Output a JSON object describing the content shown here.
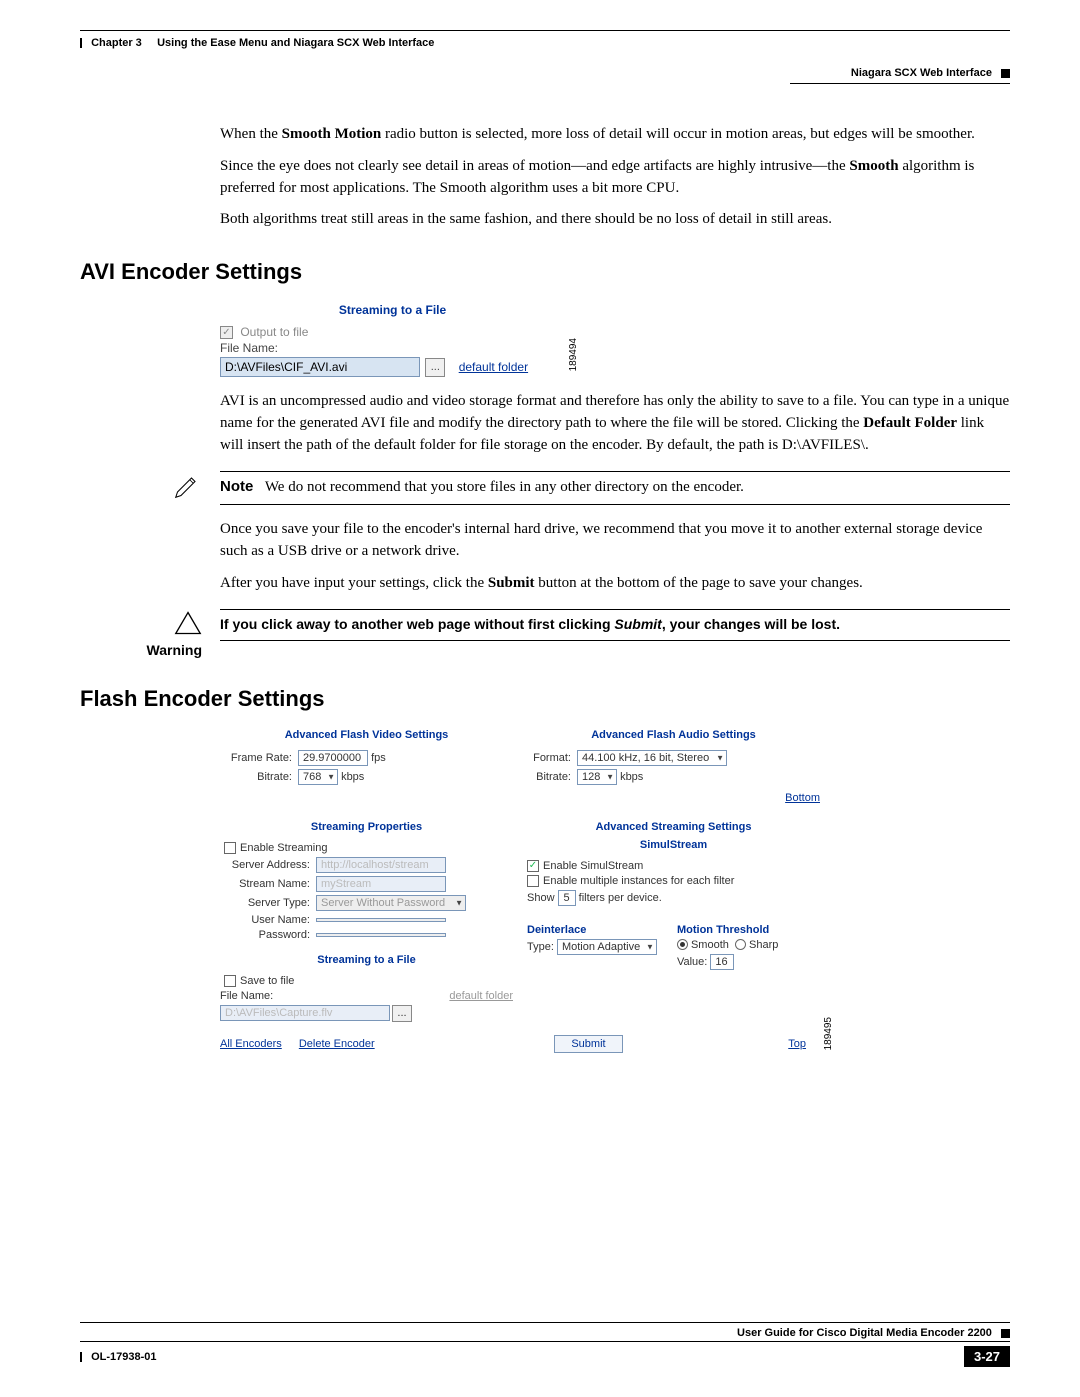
{
  "header": {
    "chapter_label": "Chapter 3",
    "chapter_title": "Using the Ease Menu and Niagara SCX Web Interface",
    "right_label": "Niagara SCX Web Interface"
  },
  "intro": {
    "p1_a": "When the ",
    "p1_b": "Smooth Motion",
    "p1_c": " radio button is selected, more loss of detail will occur in motion areas, but edges will be smoother.",
    "p2_a": "Since the eye does not clearly see detail in areas of motion—and edge artifacts are highly intrusive—the ",
    "p2_b": "Smooth",
    "p2_c": " algorithm is preferred for most applications. The Smooth algorithm uses a bit more CPU.",
    "p3": "Both algorithms treat still areas in the same fashion, and there should be no loss of detail in still areas."
  },
  "avi": {
    "heading": "AVI Encoder Settings",
    "shot": {
      "title": "Streaming to a File",
      "output_to_file": "Output to file",
      "file_name_label": "File Name:",
      "file_name_value": "D:\\AVFiles\\CIF_AVI.avi",
      "browse_label": "...",
      "default_folder": "default folder",
      "fignum": "189494"
    },
    "p1_a": "AVI is an uncompressed audio and video storage format and therefore has only the ability to save to a file. You can type in a unique name for the generated AVI file and modify the directory path to where the file will be stored. Clicking the ",
    "p1_b": "Default Folder",
    "p1_c": " link will insert the path of the default folder for file storage on the encoder. By default, the path is D:\\AVFILES\\.",
    "note_label": "Note",
    "note_text": "We do not recommend that you store files in any other directory on the encoder.",
    "p2": "Once you save your file to the encoder's internal hard drive, we recommend that you move it to another external storage device such as a USB drive or a network drive.",
    "p3_a": "After you have input your settings, click the ",
    "p3_b": "Submit",
    "p3_c": " button at the bottom of the page to save your changes.",
    "warn_label": "Warning",
    "warn_a": "If you click away to another web page without first clicking ",
    "warn_b": "Submit",
    "warn_c": ", your changes will be lost."
  },
  "flash": {
    "heading": "Flash Encoder Settings",
    "video": {
      "title": "Advanced Flash Video Settings",
      "frame_rate_label": "Frame Rate:",
      "frame_rate_value": "29.9700000",
      "frame_rate_unit": "fps",
      "bitrate_label": "Bitrate:",
      "bitrate_value": "768",
      "bitrate_unit": "kbps"
    },
    "audio": {
      "title": "Advanced Flash Audio Settings",
      "format_label": "Format:",
      "format_value": "44.100 kHz, 16 bit, Stereo",
      "bitrate_label": "Bitrate:",
      "bitrate_value": "128",
      "bitrate_unit": "kbps"
    },
    "bottom_link": "Bottom",
    "streaming_props": {
      "title": "Streaming Properties",
      "enable_streaming": "Enable Streaming",
      "server_address_label": "Server Address:",
      "server_address_hint": "http://localhost/stream",
      "stream_name_label": "Stream Name:",
      "stream_name_hint": "myStream",
      "server_type_label": "Server Type:",
      "server_type_value": "Server Without Password",
      "user_name_label": "User Name:",
      "password_label": "Password:"
    },
    "adv_stream": {
      "title": "Advanced Streaming Settings",
      "subtitle": "SimulStream",
      "enable_simul": "Enable SimulStream",
      "enable_multi": "Enable multiple instances for each filter",
      "show_a": "Show",
      "show_val": "5",
      "show_b": "filters per device.",
      "deint_title": "Deinterlace",
      "deint_type_label": "Type:",
      "deint_type_value": "Motion Adaptive",
      "mt_title": "Motion Threshold",
      "mt_smooth": "Smooth",
      "mt_sharp": "Sharp",
      "mt_value_label": "Value:",
      "mt_value": "16"
    },
    "save_file": {
      "title": "Streaming to a File",
      "save_to_file": "Save to file",
      "file_name_label": "File Name:",
      "default_folder": "default folder",
      "file_name_hint": "D:\\AVFiles\\Capture.flv",
      "browse_label": "..."
    },
    "actions": {
      "all_encoders": "All Encoders",
      "delete_encoder": "Delete Encoder",
      "submit": "Submit",
      "top": "Top"
    },
    "fignum": "189495"
  },
  "footer": {
    "guide": "User Guide for Cisco Digital Media Encoder 2200",
    "docid": "OL-17938-01",
    "page": "3-27"
  }
}
